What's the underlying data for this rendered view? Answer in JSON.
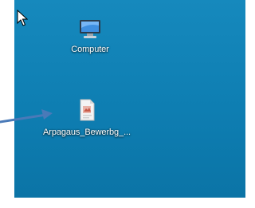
{
  "desktop": {
    "background_color": "#0f7fb3",
    "icons": [
      {
        "label": "Computer",
        "icon": "computer-monitor-icon"
      },
      {
        "label": "Arpagaus_Bewerbg_...",
        "icon": "document-file-icon"
      }
    ]
  },
  "annotation": {
    "arrow_color": "#4a7ab8",
    "points_to": "file icon"
  },
  "cursor": {
    "icon": "mouse-pointer-icon"
  }
}
